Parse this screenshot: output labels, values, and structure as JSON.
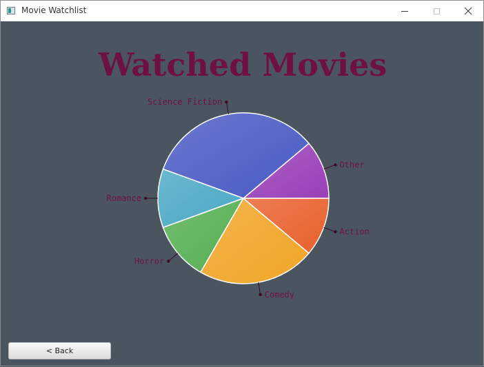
{
  "window": {
    "title": "Movie Watchlist"
  },
  "chart_data": {
    "type": "pie",
    "title": "Watched Movies",
    "slices": [
      {
        "label": "Other",
        "value": 11.1,
        "color": "#9a3fb8"
      },
      {
        "label": "Science Fiction",
        "value": 33.3,
        "color": "#4a5ac4"
      },
      {
        "label": "Romance",
        "value": 11.1,
        "color": "#4aa8c4"
      },
      {
        "label": "Horror",
        "value": 11.1,
        "color": "#56ae52"
      },
      {
        "label": "Comedy",
        "value": 22.2,
        "color": "#f0a526"
      },
      {
        "label": "Action",
        "value": 11.1,
        "color": "#e8602c"
      }
    ],
    "label_color": "#6e1142"
  },
  "footer": {
    "back_label": "< Back"
  }
}
